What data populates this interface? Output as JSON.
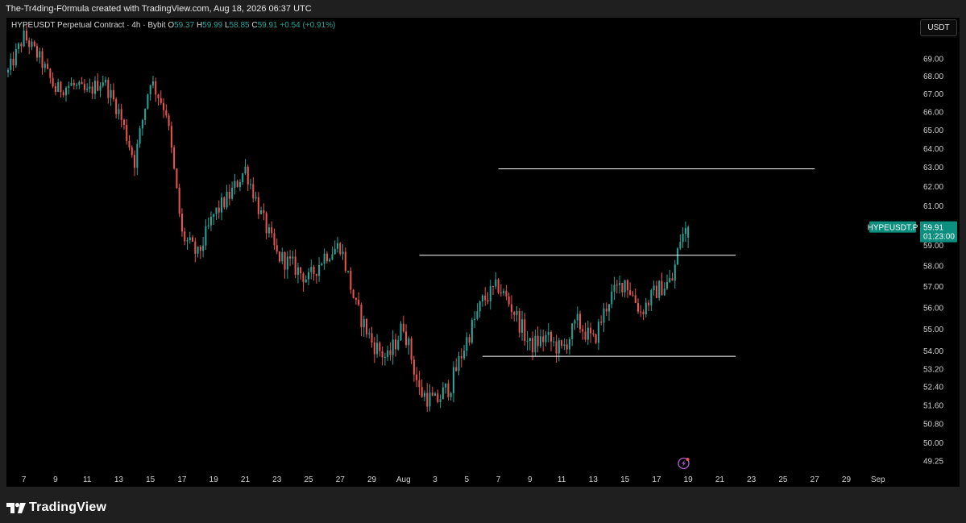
{
  "header": {
    "caption": "The-Tr4ding-F0rmula created with TradingView.com, Aug 18, 2026 06:37 UTC"
  },
  "legend": {
    "symbol": "HYPEUSDT Perpetual Contract · 4h · Bybit",
    "o_label": "O",
    "o_value": "59.37",
    "h_label": "H",
    "h_value": "59.99",
    "l_label": "L",
    "l_value": "58.85",
    "c_label": "C",
    "c_value": "59.91",
    "change": "+0.54 (+0.91%)"
  },
  "currency_button": "USDT",
  "price_tag": {
    "symbol": "HYPEUSDT.P",
    "price": "59.91",
    "countdown": "01:23:00"
  },
  "footer": {
    "brand": "TradingView"
  },
  "colors": {
    "up": "#26a69a",
    "down": "#ef5350",
    "background": "#000000",
    "frame": "#1f1f1f",
    "axis_text": "#cfcfcf",
    "lines": "#ffffff"
  },
  "icons": {
    "alert": "lightning-icon"
  },
  "chart_data": {
    "type": "candlestick",
    "title": "HYPEUSDT Perpetual Contract",
    "timeframe": "4h",
    "exchange": "Bybit",
    "x_tick_labels": [
      "7",
      "9",
      "11",
      "13",
      "15",
      "17",
      "19",
      "21",
      "23",
      "25",
      "27",
      "29",
      "Aug",
      "3",
      "5",
      "7",
      "9",
      "11",
      "13",
      "15",
      "17",
      "19",
      "21",
      "23",
      "25",
      "27",
      "29",
      "Sep"
    ],
    "x_range": [
      "Jul 6",
      "Sep 1"
    ],
    "y_tick_labels": [
      "69.00",
      "68.00",
      "67.00",
      "66.00",
      "65.00",
      "64.00",
      "63.00",
      "62.00",
      "61.00",
      "59.00",
      "58.00",
      "57.00",
      "56.00",
      "55.00",
      "54.00",
      "53.20",
      "52.40",
      "51.60",
      "50.80",
      "50.00",
      "49.25"
    ],
    "y_scale": "log",
    "ylim": [
      48.9,
      71.4
    ],
    "horizontal_lines": [
      {
        "price": 62.9,
        "from": "Aug 6",
        "to": "Aug 26"
      },
      {
        "price": 58.5,
        "from": "Aug 1",
        "to": "Aug 21"
      },
      {
        "price": 53.75,
        "from": "Aug 5",
        "to": "Aug 21"
      }
    ],
    "path": [
      [
        "Jul 6",
        68.2
      ],
      [
        "Jul 7",
        70.3
      ],
      [
        "Jul 8",
        69.0
      ],
      [
        "Jul 9",
        67.2
      ],
      [
        "Jul 10",
        67.5
      ],
      [
        "Jul 11",
        67.0
      ],
      [
        "Jul 12",
        67.8
      ],
      [
        "Jul 13",
        66.0
      ],
      [
        "Jul 14",
        63.3
      ],
      [
        "Jul 15",
        67.8
      ],
      [
        "Jul 16",
        66.0
      ],
      [
        "Jul 17",
        59.5
      ],
      [
        "Jul 18",
        58.5
      ],
      [
        "Jul 19",
        60.5
      ],
      [
        "Jul 20",
        61.5
      ],
      [
        "Jul 21",
        62.9
      ],
      [
        "Jul 22",
        60.5
      ],
      [
        "Jul 23",
        58.5
      ],
      [
        "Jul 24",
        58.0
      ],
      [
        "Jul 25",
        57.3
      ],
      [
        "Jul 26",
        58.5
      ],
      [
        "Jul 27",
        59.0
      ],
      [
        "Jul 28",
        56.0
      ],
      [
        "Jul 29",
        54.4
      ],
      [
        "Jul 30",
        53.6
      ],
      [
        "Jul 31",
        55.2
      ],
      [
        "Aug 1",
        52.2
      ],
      [
        "Aug 2",
        51.7
      ],
      [
        "Aug 3",
        52.5
      ],
      [
        "Aug 4",
        54.5
      ],
      [
        "Aug 5",
        56.3
      ],
      [
        "Aug 6",
        57.0
      ],
      [
        "Aug 7",
        55.8
      ],
      [
        "Aug 8",
        54.2
      ],
      [
        "Aug 9",
        54.6
      ],
      [
        "Aug 10",
        54.0
      ],
      [
        "Aug 11",
        55.3
      ],
      [
        "Aug 12",
        54.4
      ],
      [
        "Aug 13",
        56.4
      ],
      [
        "Aug 14",
        57.3
      ],
      [
        "Aug 15",
        55.8
      ],
      [
        "Aug 16",
        56.8
      ],
      [
        "Aug 17",
        57.3
      ],
      [
        "Aug 17 12:00",
        59.3
      ],
      [
        "Aug 18",
        59.91
      ]
    ],
    "last": {
      "open": 59.37,
      "high": 59.99,
      "low": 58.85,
      "close": 59.91,
      "change": 0.54,
      "change_pct": 0.91
    }
  }
}
